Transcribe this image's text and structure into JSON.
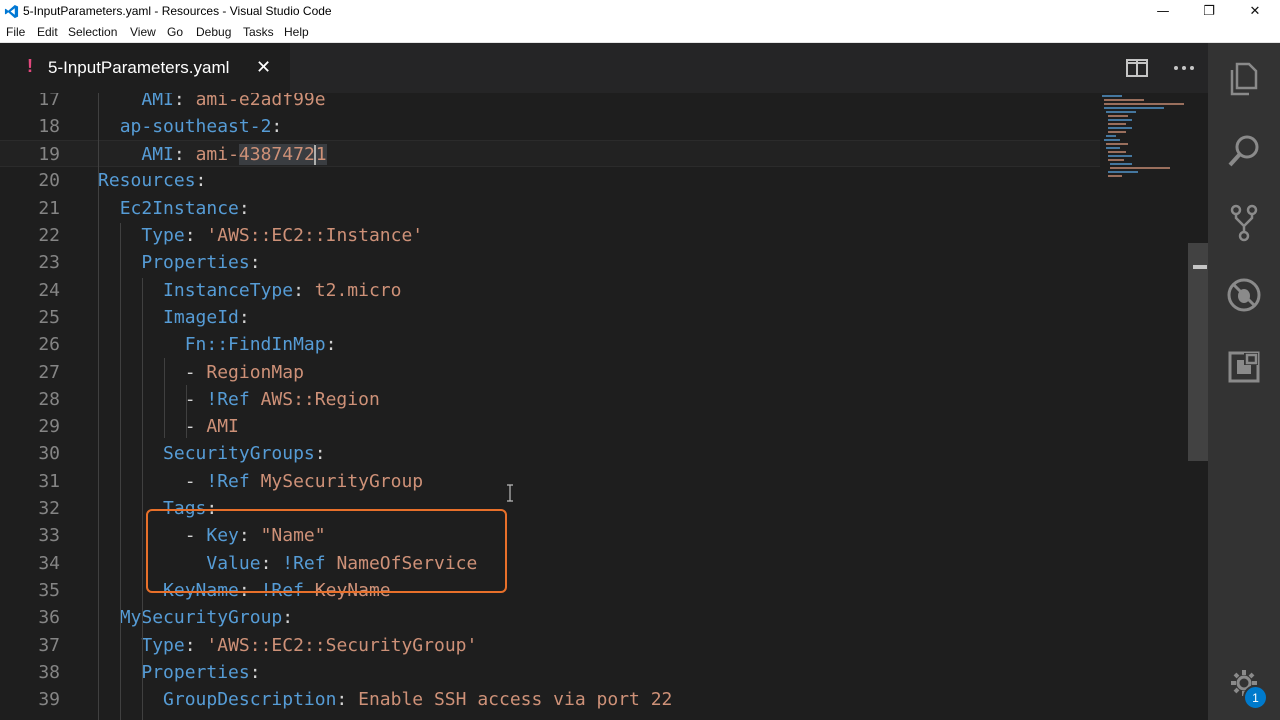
{
  "window": {
    "title": "5-InputParameters.yaml - Resources - Visual Studio Code",
    "minimize_glyph": "—",
    "maximize_glyph": "❐",
    "close_glyph": "✕"
  },
  "menu": {
    "items": [
      "File",
      "Edit",
      "Selection",
      "View",
      "Go",
      "Debug",
      "Tasks",
      "Help"
    ]
  },
  "tab": {
    "dirty_marker": "!",
    "label": "5-InputParameters.yaml",
    "close_glyph": "✕"
  },
  "tab_actions": [
    "split-editor-icon",
    "more-actions-icon"
  ],
  "activity_bar": {
    "icons": [
      "explorer-icon",
      "search-icon",
      "source-control-icon",
      "debug-icon",
      "extensions-icon",
      "gear-icon"
    ],
    "badge_count": "1"
  },
  "editor": {
    "lines": [
      {
        "n": "17",
        "tokens": [
          [
            "p",
            "    "
          ],
          [
            "k",
            "AMI"
          ],
          [
            "p",
            ": "
          ],
          [
            "s",
            "ami-e2adf99e"
          ]
        ]
      },
      {
        "n": "18",
        "tokens": [
          [
            "p",
            "  "
          ],
          [
            "k",
            "ap-southeast-2"
          ],
          [
            "p",
            ":"
          ]
        ]
      },
      {
        "n": "19",
        "tokens": [
          [
            "p",
            "    "
          ],
          [
            "k",
            "AMI"
          ],
          [
            "p",
            ": "
          ],
          [
            "s",
            "ami-"
          ],
          [
            "hl",
            "43874721"
          ]
        ],
        "current": true
      },
      {
        "n": "20",
        "tokens": [
          [
            "k",
            "Resources"
          ],
          [
            "p",
            ":"
          ]
        ]
      },
      {
        "n": "21",
        "tokens": [
          [
            "p",
            "  "
          ],
          [
            "k",
            "Ec2Instance"
          ],
          [
            "p",
            ":"
          ]
        ]
      },
      {
        "n": "22",
        "tokens": [
          [
            "p",
            "    "
          ],
          [
            "k",
            "Type"
          ],
          [
            "p",
            ": "
          ],
          [
            "s",
            "'AWS::EC2::Instance'"
          ]
        ]
      },
      {
        "n": "23",
        "tokens": [
          [
            "p",
            "    "
          ],
          [
            "k",
            "Properties"
          ],
          [
            "p",
            ":"
          ]
        ]
      },
      {
        "n": "24",
        "tokens": [
          [
            "p",
            "      "
          ],
          [
            "k",
            "InstanceType"
          ],
          [
            "p",
            ": "
          ],
          [
            "s",
            "t2.micro"
          ]
        ]
      },
      {
        "n": "25",
        "tokens": [
          [
            "p",
            "      "
          ],
          [
            "k",
            "ImageId"
          ],
          [
            "p",
            ":"
          ]
        ]
      },
      {
        "n": "26",
        "tokens": [
          [
            "p",
            "        "
          ],
          [
            "k",
            "Fn::FindInMap"
          ],
          [
            "p",
            ":"
          ]
        ]
      },
      {
        "n": "27",
        "tokens": [
          [
            "p",
            "        - "
          ],
          [
            "s",
            "RegionMap"
          ]
        ]
      },
      {
        "n": "28",
        "tokens": [
          [
            "p",
            "        - "
          ],
          [
            "k",
            "!Ref"
          ],
          [
            "p",
            " "
          ],
          [
            "s",
            "AWS::Region"
          ]
        ]
      },
      {
        "n": "29",
        "tokens": [
          [
            "p",
            "        - "
          ],
          [
            "s",
            "AMI"
          ]
        ]
      },
      {
        "n": "30",
        "tokens": [
          [
            "p",
            "      "
          ],
          [
            "k",
            "SecurityGroups"
          ],
          [
            "p",
            ":"
          ]
        ]
      },
      {
        "n": "31",
        "tokens": [
          [
            "p",
            "        - "
          ],
          [
            "k",
            "!Ref"
          ],
          [
            "p",
            " "
          ],
          [
            "s",
            "MySecurityGroup"
          ]
        ]
      },
      {
        "n": "32",
        "tokens": [
          [
            "p",
            "      "
          ],
          [
            "k",
            "Tags"
          ],
          [
            "p",
            ":"
          ]
        ]
      },
      {
        "n": "33",
        "tokens": [
          [
            "p",
            "        - "
          ],
          [
            "k",
            "Key"
          ],
          [
            "p",
            ": "
          ],
          [
            "s",
            "\"Name\""
          ]
        ]
      },
      {
        "n": "34",
        "tokens": [
          [
            "p",
            "          "
          ],
          [
            "k",
            "Value"
          ],
          [
            "p",
            ": "
          ],
          [
            "k",
            "!Ref"
          ],
          [
            "p",
            " "
          ],
          [
            "s",
            "NameOfService"
          ]
        ]
      },
      {
        "n": "35",
        "tokens": [
          [
            "p",
            "      "
          ],
          [
            "k",
            "KeyName"
          ],
          [
            "p",
            ": "
          ],
          [
            "k",
            "!Ref"
          ],
          [
            "p",
            " "
          ],
          [
            "s",
            "KeyName"
          ]
        ]
      },
      {
        "n": "36",
        "tokens": [
          [
            "p",
            "  "
          ],
          [
            "k",
            "MySecurityGroup"
          ],
          [
            "p",
            ":"
          ]
        ]
      },
      {
        "n": "37",
        "tokens": [
          [
            "p",
            "    "
          ],
          [
            "k",
            "Type"
          ],
          [
            "p",
            ": "
          ],
          [
            "s",
            "'AWS::EC2::SecurityGroup'"
          ]
        ]
      },
      {
        "n": "38",
        "tokens": [
          [
            "p",
            "    "
          ],
          [
            "k",
            "Properties"
          ],
          [
            "p",
            ":"
          ]
        ]
      },
      {
        "n": "39",
        "tokens": [
          [
            "p",
            "      "
          ],
          [
            "k",
            "GroupDescription"
          ],
          [
            "p",
            ": "
          ],
          [
            "s",
            "Enable SSH access via port 22"
          ]
        ]
      }
    ],
    "highlighted_range": "lines 32-34"
  },
  "colors": {
    "background": "#1e1e1e",
    "key": "#569cd6",
    "string": "#ce9178",
    "highlight_box": "#e8702a",
    "badge": "#007acc"
  }
}
